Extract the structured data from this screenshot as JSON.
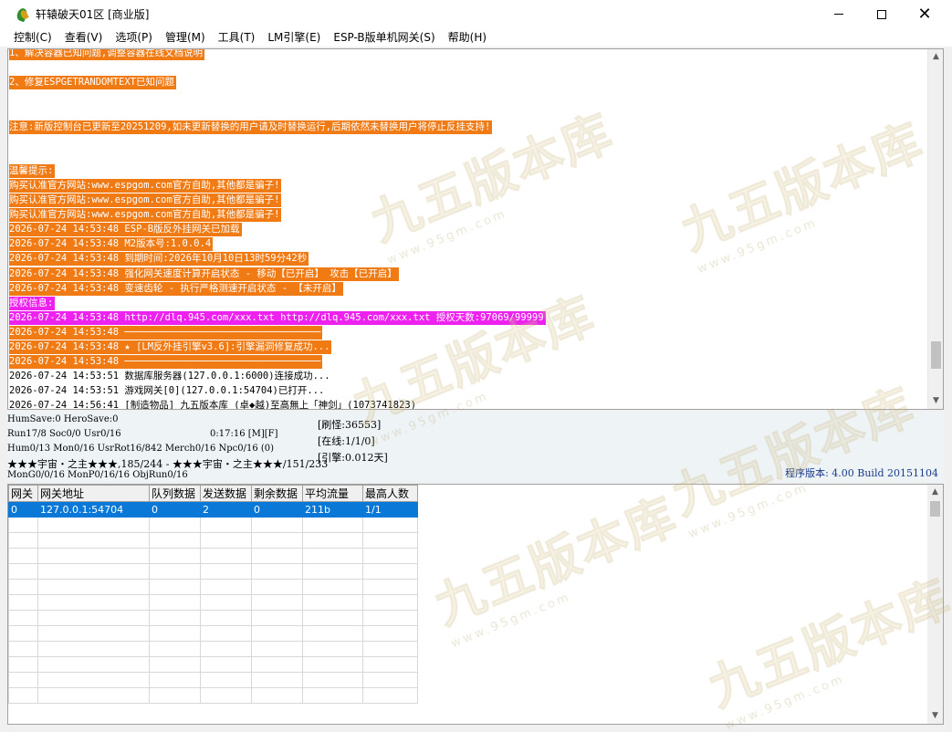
{
  "window": {
    "title": "轩辕破天01区 [商业版]",
    "controls": {
      "minimize": "minimize",
      "maximize": "maximize",
      "close": "close"
    }
  },
  "menu": [
    "控制(C)",
    "查看(V)",
    "选项(P)",
    "管理(M)",
    "工具(T)",
    "LM引擎(E)",
    "ESP-B版单机网关(S)",
    "帮助(H)"
  ],
  "log": [
    {
      "text": "1、解决容器已知问题,调整容器在线文档说明",
      "style": "orange"
    },
    {
      "text": "",
      "style": "plain"
    },
    {
      "text": "2、修复ESPGETRANDOMTEXT已知问题",
      "style": "orange"
    },
    {
      "text": "",
      "style": "plain"
    },
    {
      "text": "",
      "style": "plain"
    },
    {
      "text": "注意:新版控制台已更新至20251209,如未更新替换的用户请及时替换运行,后期依然未替换用户将停止反挂支持!",
      "style": "orange"
    },
    {
      "text": "",
      "style": "plain"
    },
    {
      "text": "",
      "style": "plain"
    },
    {
      "text": "温馨提示:",
      "style": "orange"
    },
    {
      "text": "购买认准官方网站:www.espgom.com官方自助,其他都是骗子!",
      "style": "orange"
    },
    {
      "text": "购买认准官方网站:www.espgom.com官方自助,其他都是骗子!",
      "style": "orange"
    },
    {
      "text": "购买认准官方网站:www.espgom.com官方自助,其他都是骗子!",
      "style": "orange"
    },
    {
      "text": "2026-07-24 14:53:48 ESP-B版反外挂网关已加载",
      "style": "orange"
    },
    {
      "text": "2026-07-24 14:53:48 M2版本号:1.0.0.4",
      "style": "orange"
    },
    {
      "text": "2026-07-24 14:53:48 到期时间:2026年10月10日13时59分42秒",
      "style": "orange"
    },
    {
      "text": "2026-07-24 14:53:48 强化网关速度计算开启状态 - 移动【已开启】 攻击【已开启】",
      "style": "orange"
    },
    {
      "text": "2026-07-24 14:53:48 变速齿轮 - 执行严格测速开启状态 - 【未开启】",
      "style": "orange"
    },
    {
      "text": "授权信息:",
      "style": "magenta"
    },
    {
      "text": "2026-07-24 14:53:48 http://dlq.945.com/xxx.txt http://dlq.945.com/xxx.txt 授权天数:97069/99999",
      "style": "magenta"
    },
    {
      "text": "2026-07-24 14:53:48 ──────────────────────────────────",
      "style": "orange"
    },
    {
      "text": "2026-07-24 14:53:48 ★ [LM反外挂引擎v3.6]:引擎漏洞修复成功...",
      "style": "orange"
    },
    {
      "text": "2026-07-24 14:53:48 ──────────────────────────────────",
      "style": "orange"
    },
    {
      "text": "2026-07-24 14:53:51 数据库服务器(127.0.0.1:6000)连接成功...",
      "style": "plain"
    },
    {
      "text": "2026-07-24 14:53:51 游戏网关[0](127.0.0.1:54704)已打开...",
      "style": "plain"
    },
    {
      "text": "2026-07-24 14:56:41 [制造物品] 九五版本库 (卓◆越)至高無上「神剑」(1073741823)",
      "style": "plain"
    }
  ],
  "status": {
    "line1": "HumSave:0 HeroSave:0",
    "line2_left": "Run17/8 Soc0/0 Usr0/16",
    "line2_time": "0:17:16 [M][F]",
    "line3": "Hum0/13 Mon0/16 UsrRot16/842 Merch0/16 Npc0/16 (0)",
    "line4": "★★★宇宙・之主★★★,185/244 - ★★★宇宙・之主★★★/151/233",
    "line5": "MonG0/0/16 MonP0/16/16 ObjRun0/16",
    "refresh": "[刷怪:36553]",
    "online": "[在线:1/1/0]",
    "engine": "[引擎:0.012天]",
    "version": "程序版本: 4.00 Build 20151104"
  },
  "grid": {
    "headers": [
      "网关",
      "网关地址",
      "队列数据",
      "发送数据",
      "剩余数据",
      "平均流量",
      "最高人数"
    ],
    "rows": [
      [
        "0",
        "127.0.0.1:54704",
        "0",
        "2",
        "0",
        "211b",
        "1/1"
      ]
    ],
    "empty_rows": 12
  },
  "watermark": {
    "main": "九五版本库",
    "sub": "www.95gm.com"
  }
}
